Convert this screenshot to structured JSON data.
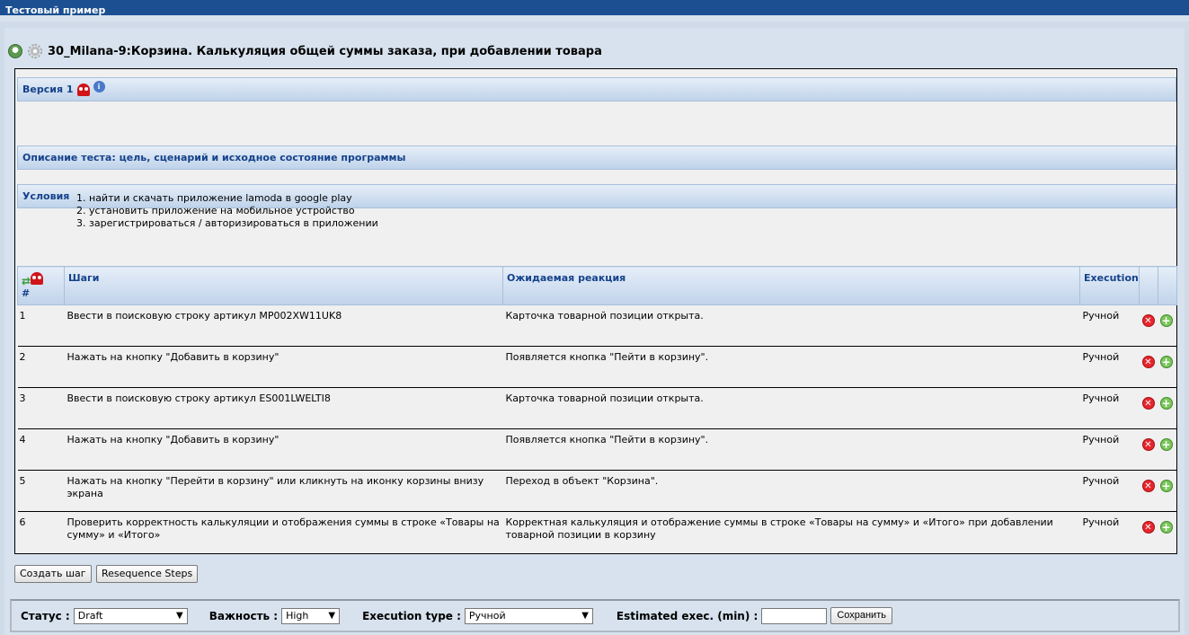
{
  "window": {
    "title": "Тестовый пример"
  },
  "test": {
    "title": "30_Milana-9:Корзина. Калькуляция общей суммы заказа, при добавлении товара"
  },
  "version": {
    "label": "Версия 1"
  },
  "sections": {
    "description": "Описание теста: цель, сценарий и исходное состояние программы",
    "conditions_title": "Условия",
    "conditions": [
      "найти и скачать приложение lamoda в google play",
      "установить приложение на мобильное устройство",
      "зарегистрироваться / авторизироваться в приложении"
    ]
  },
  "steps_table": {
    "headers": {
      "num": "#",
      "steps": "Шаги",
      "expected": "Ожидаемая реакция",
      "execution": "Execution"
    },
    "rows": [
      {
        "num": "1",
        "step": "Ввести в поисковую строку артикул MP002XW11UK8",
        "expected": "Карточка товарной позиции открыта.",
        "execution": "Ручной"
      },
      {
        "num": "2",
        "step": "Нажать на кнопку \"Добавить в корзину\"",
        "expected": "Появляется кнопка \"Пейти в корзину\".",
        "execution": "Ручной"
      },
      {
        "num": "3",
        "step": "Ввести в поисковую строку артикул ES001LWELTI8",
        "expected": "Карточка товарной позиции открыта.",
        "execution": "Ручной"
      },
      {
        "num": "4",
        "step": "Нажать на кнопку \"Добавить в корзину\"",
        "expected": "Появляется кнопка \"Пейти в корзину\".",
        "execution": "Ручной"
      },
      {
        "num": "5",
        "step": "Нажать на кнопку \"Перейти в корзину\" или кликнуть на иконку корзины внизу экрана",
        "expected": "Переход в объект \"Корзина\".",
        "execution": "Ручной"
      },
      {
        "num": "6",
        "step": "Проверить корректность калькуляции и отображения суммы в строке «Товары на сумму» и «Итого»",
        "expected": "Корректная калькуляция и отображение суммы в строке «Товары на сумму» и «Итого» при добавлении товарной позиции в корзину",
        "execution": "Ручной"
      }
    ]
  },
  "buttons": {
    "create_step": "Создать шаг",
    "resequence": "Resequence Steps",
    "save": "Сохранить"
  },
  "status_bar": {
    "status_label": "Статус :",
    "status_value": "Draft",
    "importance_label": "Важность :",
    "importance_value": "High",
    "exec_type_label": "Execution type :",
    "exec_type_value": "Ручной",
    "estimated_label": "Estimated exec. (min) :",
    "estimated_value": ""
  },
  "colors": {
    "titlebar": "#1b4f91",
    "header_text": "#15428b",
    "background": "#d7e2ee",
    "panel": "#f0f0f0"
  }
}
